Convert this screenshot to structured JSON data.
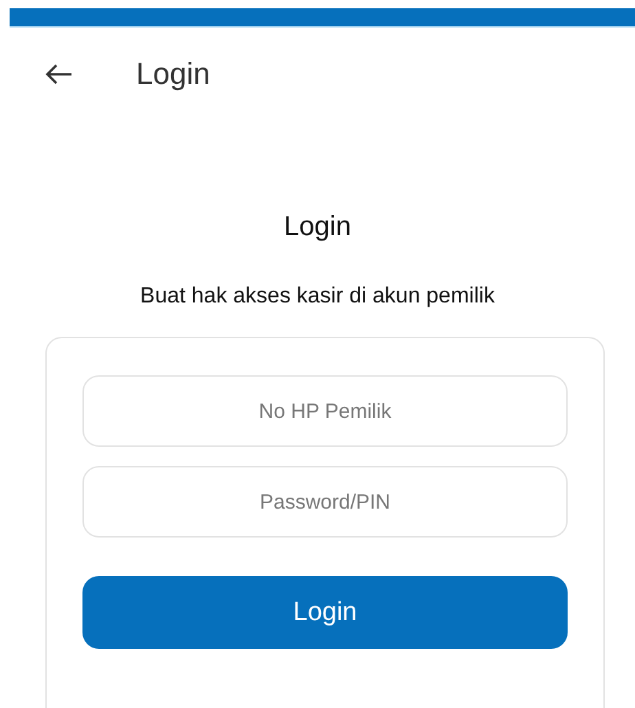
{
  "app_bar": {
    "title": "Login"
  },
  "form": {
    "heading": "Login",
    "subtitle": "Buat hak akses kasir di akun pemilik",
    "fields": [
      {
        "placeholder": "No HP Pemilik"
      },
      {
        "placeholder": "Password/PIN"
      }
    ],
    "submit": "Login"
  }
}
